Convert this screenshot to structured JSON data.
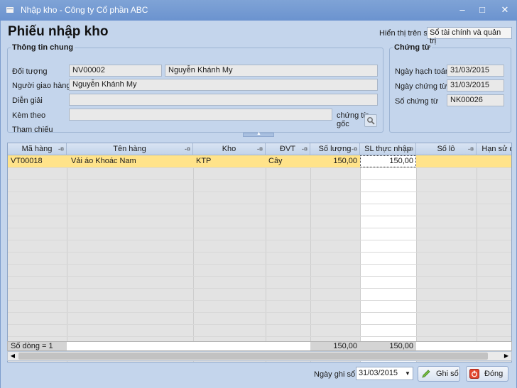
{
  "window": {
    "title": "Nhập kho - Công ty Cổ phần ABC",
    "min": "–",
    "max": "□",
    "close": "✕"
  },
  "header": {
    "page_title": "Phiếu nhập kho",
    "hien_thi_label": "Hiển thị trên sổ",
    "hien_thi_value": "Sổ tài chính và quản trị"
  },
  "thong_tin_chung": {
    "legend": "Thông tin chung",
    "doi_tuong_label": "Đối tượng",
    "doi_tuong_code": "NV00002",
    "doi_tuong_name": "Nguyễn Khánh My",
    "nguoi_giao_label": "Người giao hàng",
    "nguoi_giao_value": "Nguyễn Khánh My",
    "dien_giai_label": "Diễn giải",
    "dien_giai_value": "",
    "kem_theo_label": "Kèm theo",
    "kem_theo_value": "",
    "chung_tu_goc": "chứng từ gốc",
    "tham_chieu_label": "Tham chiếu"
  },
  "chung_tu": {
    "legend": "Chứng từ",
    "ngay_hach_toan_label": "Ngày hạch toán",
    "ngay_hach_toan": "31/03/2015",
    "ngay_chung_tu_label": "Ngày chứng từ",
    "ngay_chung_tu": "31/03/2015",
    "so_chung_tu_label": "Số chứng từ",
    "so_chung_tu": "NK00026"
  },
  "grid": {
    "columns": [
      "Mã hàng",
      "Tên hàng",
      "Kho",
      "ĐVT",
      "Số lượng",
      "SL thực nhập",
      "Số lô",
      "Hạn sử d"
    ],
    "rows": [
      {
        "ma_hang": "VT00018",
        "ten_hang": "Vải áo Khoác Nam",
        "kho": "KTP",
        "dvt": "Cây",
        "so_luong": "150,00",
        "sl_thuc_nhap": "150,00"
      }
    ],
    "footer": {
      "so_dong": "Số dòng = 1",
      "tong_so_luong": "150,00",
      "tong_sl_thuc_nhap": "150,00"
    }
  },
  "bottom": {
    "ngay_ghi_so_label": "Ngày ghi sổ",
    "ngay_ghi_so": "31/03/2015",
    "ghi_so": "Ghi sổ",
    "dong": "Đóng"
  }
}
